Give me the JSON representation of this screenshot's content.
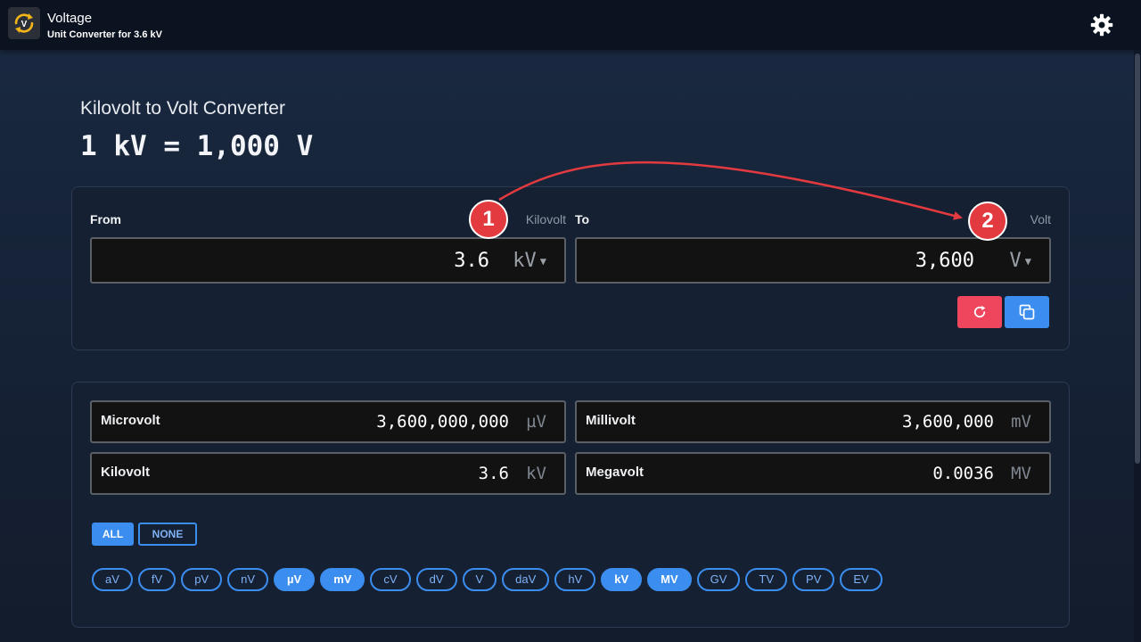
{
  "header": {
    "app_title": "Voltage",
    "app_subtitle": "Unit Converter for 3.6 kV",
    "settings_icon": "gear-icon"
  },
  "converter": {
    "title": "Kilovolt to Volt Converter",
    "equation": "1 kV = 1,000 V",
    "from": {
      "label": "From",
      "unit_name": "Kilovolt",
      "value": "3.6",
      "unit": "kV"
    },
    "to": {
      "label": "To",
      "unit_name": "Volt",
      "value": "3,600",
      "unit": "V"
    },
    "reset_icon": "refresh-icon",
    "copy_icon": "copy-icon"
  },
  "results": [
    {
      "name": "Microvolt",
      "value": "3,600,000,000",
      "unit": "µV"
    },
    {
      "name": "Millivolt",
      "value": "3,600,000",
      "unit": "mV"
    },
    {
      "name": "Kilovolt",
      "value": "3.6",
      "unit": "kV"
    },
    {
      "name": "Megavolt",
      "value": "0.0036",
      "unit": "MV"
    }
  ],
  "filters": {
    "all_label": "ALL",
    "none_label": "NONE",
    "units": [
      {
        "label": "aV",
        "active": false
      },
      {
        "label": "fV",
        "active": false
      },
      {
        "label": "pV",
        "active": false
      },
      {
        "label": "nV",
        "active": false
      },
      {
        "label": "µV",
        "active": true
      },
      {
        "label": "mV",
        "active": true
      },
      {
        "label": "cV",
        "active": false
      },
      {
        "label": "dV",
        "active": false
      },
      {
        "label": "V",
        "active": false
      },
      {
        "label": "daV",
        "active": false
      },
      {
        "label": "hV",
        "active": false
      },
      {
        "label": "kV",
        "active": true
      },
      {
        "label": "MV",
        "active": true
      },
      {
        "label": "GV",
        "active": false
      },
      {
        "label": "TV",
        "active": false
      },
      {
        "label": "PV",
        "active": false
      },
      {
        "label": "EV",
        "active": false
      }
    ]
  },
  "annotations": {
    "badge_1": "1",
    "badge_2": "2",
    "arrow_color": "#e23a3f"
  },
  "colors": {
    "accent": "#3b8ef0",
    "danger": "#f0465d",
    "background": "#162338"
  }
}
